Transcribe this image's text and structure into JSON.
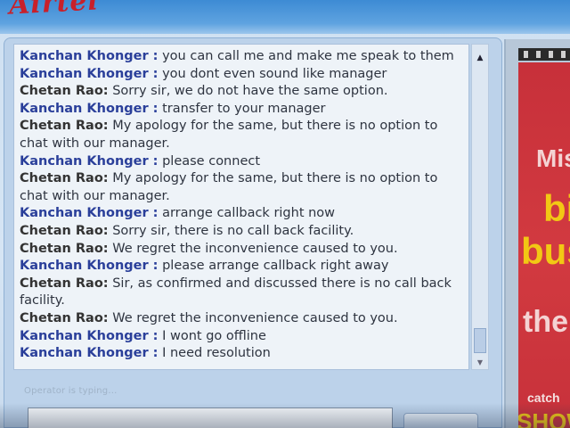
{
  "banner": {
    "logo_text": "Airtel"
  },
  "chat": {
    "messages": [
      {
        "role": "customer",
        "sender": "Kanchan Khonger :",
        "text": "you can call me and make me speak to them"
      },
      {
        "role": "customer",
        "sender": "Kanchan Khonger :",
        "text": "you dont even sound like manager"
      },
      {
        "role": "agent",
        "sender": "Chetan Rao:",
        "text": "Sorry sir, we do not have the same option."
      },
      {
        "role": "customer",
        "sender": "Kanchan Khonger :",
        "text": "transfer to your manager"
      },
      {
        "role": "agent",
        "sender": "Chetan Rao:",
        "text": "My apology for the same, but there is no option to chat with our manager."
      },
      {
        "role": "customer",
        "sender": "Kanchan Khonger :",
        "text": "please connect"
      },
      {
        "role": "agent",
        "sender": "Chetan Rao:",
        "text": "My apology for the same, but there is no option to chat with our manager."
      },
      {
        "role": "customer",
        "sender": "Kanchan Khonger :",
        "text": "arrange callback right now"
      },
      {
        "role": "agent",
        "sender": "Chetan Rao:",
        "text": "Sorry sir, there is no call back facility."
      },
      {
        "role": "agent",
        "sender": "Chetan Rao:",
        "text": "We regret the inconvenience caused to you."
      },
      {
        "role": "customer",
        "sender": "Kanchan Khonger :",
        "text": "please arrange callback right away"
      },
      {
        "role": "agent",
        "sender": "Chetan Rao:",
        "text": "Sir, as confirmed and discussed there is no call back facility."
      },
      {
        "role": "agent",
        "sender": "Chetan Rao:",
        "text": "We regret the inconvenience caused to you."
      },
      {
        "role": "customer",
        "sender": "Kanchan Khonger :",
        "text": "I wont go offline"
      },
      {
        "role": "customer",
        "sender": "Kanchan Khonger :",
        "text": "I need resolution"
      }
    ],
    "typing_status": "Operator is typing...",
    "input_value": "",
    "colors": {
      "customer_name": "#2a3f9a",
      "agent_name": "#333333"
    }
  },
  "ad": {
    "line1": "Mis",
    "line2": "bi",
    "line3": "bus",
    "line4": "the",
    "line5": "catch",
    "line6": "SHOW",
    "colors": {
      "background": "#c7303a",
      "highlight": "#f2c814"
    }
  },
  "icons": {
    "scroll_up": "chevron-up-icon",
    "scroll_down": "chevron-down-icon"
  }
}
